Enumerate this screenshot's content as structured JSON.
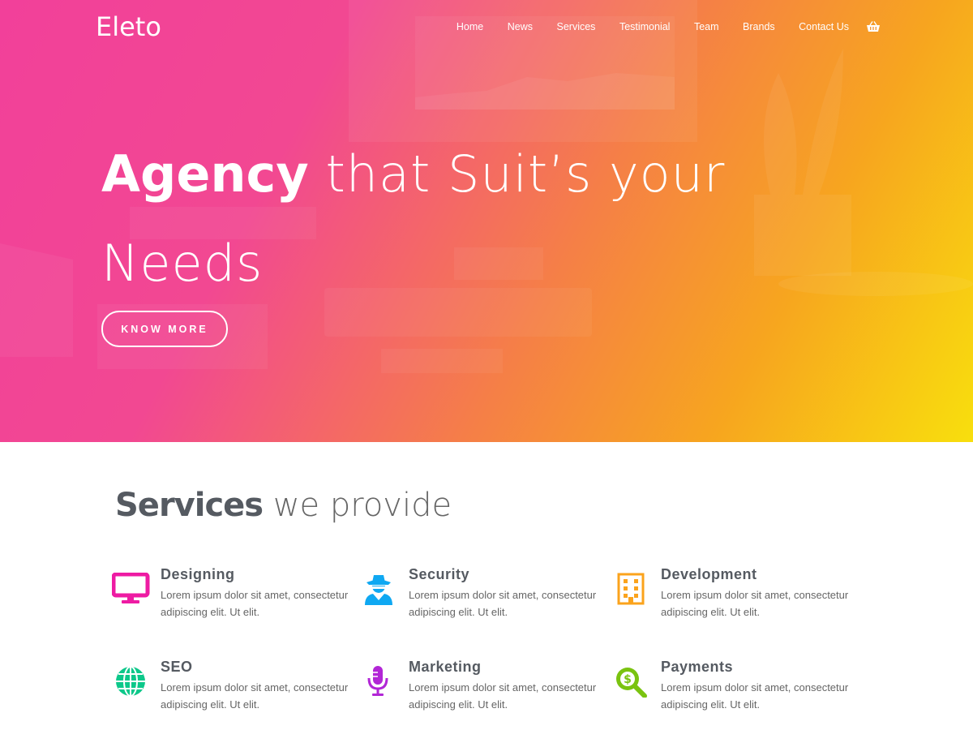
{
  "brand": {
    "logo": "Eleto"
  },
  "nav": {
    "items": [
      "Home",
      "News",
      "Services",
      "Testimonial",
      "Team",
      "Brands",
      "Contact Us"
    ],
    "cart_icon": "basket-icon"
  },
  "hero": {
    "headline_bold": "Agency",
    "headline_rest": " that Suit’s your Needs",
    "button_label": "KNOW MORE",
    "gradient_colors": [
      "#f2409a",
      "#f57f47",
      "#f7a51f",
      "#f8df0d"
    ]
  },
  "services": {
    "title_bold": "Services",
    "title_light": " we provide",
    "items": [
      {
        "name": "Designing",
        "desc": "Lorem ipsum dolor sit amet, consectetur adipiscing elit. Ut elit.",
        "icon": "monitor-icon",
        "color": "#ee1ba3"
      },
      {
        "name": "Security",
        "desc": "Lorem ipsum dolor sit amet, consectetur adipiscing elit. Ut elit.",
        "icon": "spy-icon",
        "color": "#0fa8f2"
      },
      {
        "name": "Development",
        "desc": "Lorem ipsum dolor sit amet, consectetur adipiscing elit. Ut elit.",
        "icon": "building-icon",
        "color": "#fba31c"
      },
      {
        "name": "SEO",
        "desc": "Lorem ipsum dolor sit amet, consectetur adipiscing elit. Ut elit.",
        "icon": "globe-icon",
        "color": "#0cc88a"
      },
      {
        "name": "Marketing",
        "desc": "Lorem ipsum dolor sit amet, consectetur adipiscing elit. Ut elit.",
        "icon": "microphone-icon",
        "color": "#b226d6"
      },
      {
        "name": "Payments",
        "desc": "Lorem ipsum dolor sit amet, consectetur adipiscing elit. Ut elit.",
        "icon": "dollar-search-icon",
        "color": "#7ac310"
      }
    ]
  }
}
